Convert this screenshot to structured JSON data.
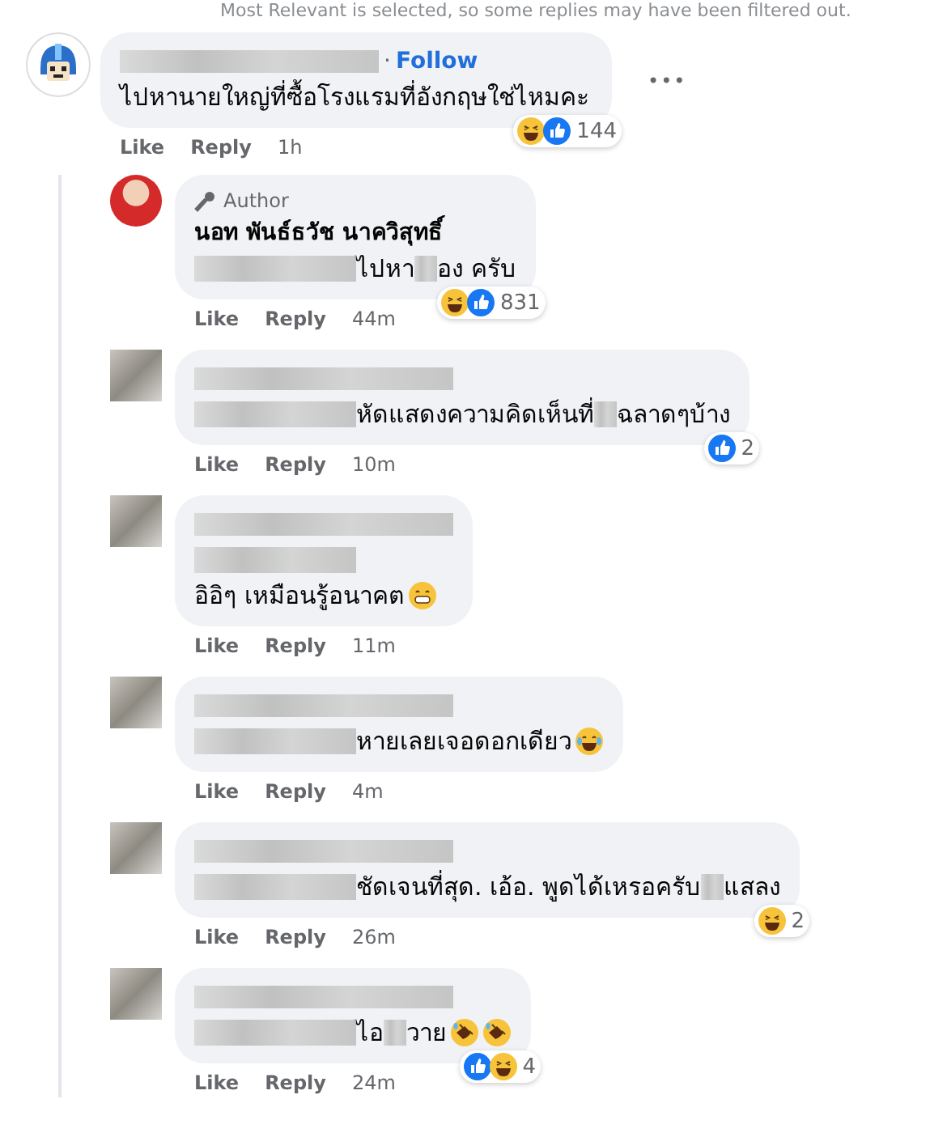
{
  "notice": "Most Relevant is selected, so some replies may have been filtered out.",
  "comment": {
    "separator": "·",
    "follow": "Follow",
    "text": "ไปหานายใหญ่ที่ซื้อโรงแรมที่อังกฤษใช่ไหมคะ",
    "menu": "•••",
    "reactions": [
      {
        "kind": "haha"
      },
      {
        "kind": "like"
      }
    ],
    "reaction_count": "144",
    "actions": [
      "Like",
      "Reply"
    ],
    "time": "1h"
  },
  "replies": [
    {
      "avatar": {
        "kind": "photo"
      },
      "badge": "Author",
      "name": "นอท พันธ์ธวัช นาควิสุทธิ์",
      "lines": [
        [
          {
            "kind": "redacted"
          },
          {
            "kind": "text",
            "text": "ไปหา"
          },
          {
            "kind": "redacted-short"
          },
          {
            "kind": "text",
            "text": "อง ครับ"
          }
        ]
      ],
      "reactions": [
        {
          "kind": "haha"
        },
        {
          "kind": "like"
        }
      ],
      "reaction_count": "831",
      "actions": [
        "Like",
        "Reply"
      ],
      "time": "44m"
    },
    {
      "avatar": {
        "kind": "blurred"
      },
      "lines": [
        [
          {
            "kind": "redacted-name"
          }
        ],
        [
          {
            "kind": "redacted"
          },
          {
            "kind": "text",
            "text": "หัดแสดงความคิดเห็นที่"
          },
          {
            "kind": "redacted-short"
          },
          {
            "kind": "text",
            "text": "ฉลาดๆบ้าง"
          }
        ]
      ],
      "reactions": [
        {
          "kind": "like"
        }
      ],
      "reaction_count": "2",
      "actions": [
        "Like",
        "Reply"
      ],
      "time": "10m"
    },
    {
      "avatar": {
        "kind": "blurred"
      },
      "lines": [
        [
          {
            "kind": "redacted-name"
          }
        ],
        [
          {
            "kind": "redacted"
          }
        ],
        [
          {
            "kind": "text",
            "text": "อิอิๆ เหมือนรู้อนาคต"
          },
          {
            "kind": "emoji-grin"
          }
        ]
      ],
      "actions": [
        "Like",
        "Reply"
      ],
      "time": "11m"
    },
    {
      "avatar": {
        "kind": "blurred"
      },
      "lines": [
        [
          {
            "kind": "redacted-name"
          }
        ],
        [
          {
            "kind": "redacted"
          },
          {
            "kind": "text",
            "text": "หายเลยเจอดอกเดียว"
          },
          {
            "kind": "emoji-joy"
          }
        ]
      ],
      "actions": [
        "Like",
        "Reply"
      ],
      "time": "4m"
    },
    {
      "avatar": {
        "kind": "blurred"
      },
      "lines": [
        [
          {
            "kind": "redacted-name"
          }
        ],
        [
          {
            "kind": "redacted"
          },
          {
            "kind": "text",
            "text": "ชัดเจนที่สุด. เอ้อ. พูดได้เหรอครับ"
          },
          {
            "kind": "redacted-short"
          },
          {
            "kind": "text",
            "text": "แสลง"
          }
        ]
      ],
      "reactions": [
        {
          "kind": "haha"
        }
      ],
      "reaction_count": "2",
      "actions": [
        "Like",
        "Reply"
      ],
      "time": "26m"
    },
    {
      "avatar": {
        "kind": "blurred"
      },
      "lines": [
        [
          {
            "kind": "redacted-name"
          }
        ],
        [
          {
            "kind": "redacted"
          },
          {
            "kind": "text",
            "text": "ไอ"
          },
          {
            "kind": "redacted-short"
          },
          {
            "kind": "text",
            "text": "วาย"
          },
          {
            "kind": "emoji-rofl"
          },
          {
            "kind": "emoji-rofl"
          }
        ]
      ],
      "reactions": [
        {
          "kind": "like"
        },
        {
          "kind": "haha"
        }
      ],
      "reaction_count": "4",
      "actions": [
        "Like",
        "Reply"
      ],
      "time": "24m"
    }
  ]
}
